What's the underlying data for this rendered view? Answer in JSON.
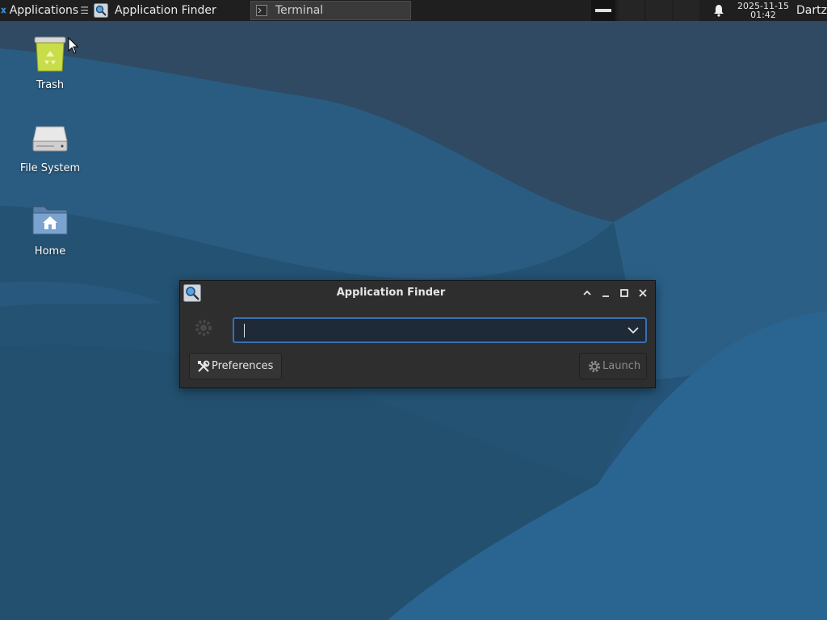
{
  "panel": {
    "applications_label": "Applications",
    "tasks": [
      {
        "label": "Application Finder",
        "icon": "search-icon",
        "active": true
      },
      {
        "label": "Terminal",
        "icon": "terminal-icon",
        "active": false
      }
    ],
    "clock_date": "2025-11-15",
    "clock_time": "01:42",
    "user": "Dartz"
  },
  "desktop": {
    "icons": [
      {
        "label": "Trash",
        "icon": "trash-icon"
      },
      {
        "label": "File System",
        "icon": "drive-icon"
      },
      {
        "label": "Home",
        "icon": "home-folder-icon"
      }
    ]
  },
  "dialog": {
    "title": "Application Finder",
    "command_value": "",
    "preferences_label": "Preferences",
    "launch_label": "Launch",
    "launch_enabled": false
  },
  "colors": {
    "panel_bg": "#1f1f1f",
    "wallpaper_base": "#255478",
    "dialog_bg": "#2e2e2e",
    "focus_border": "#3a6fb0"
  }
}
